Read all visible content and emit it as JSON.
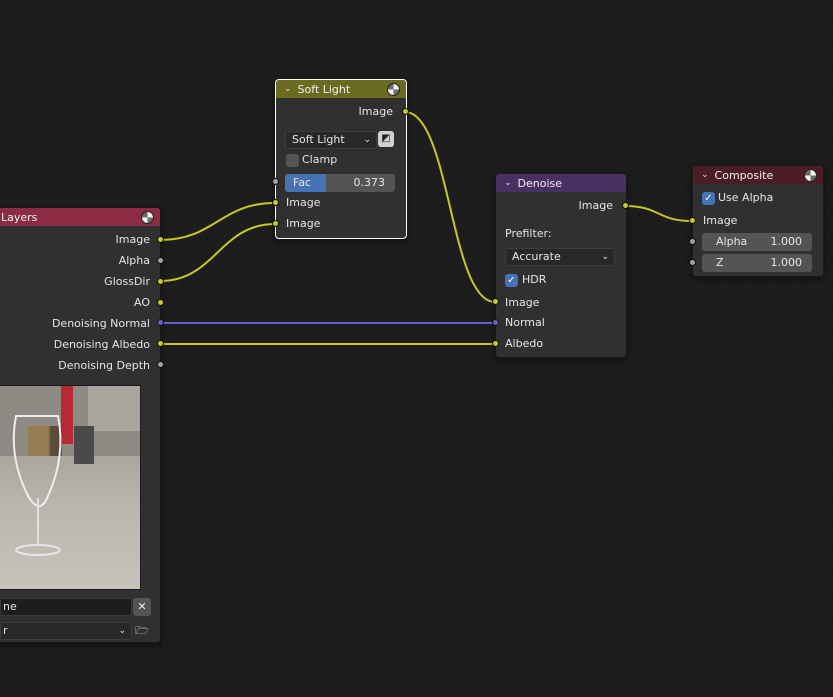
{
  "nodes": {
    "render_layers": {
      "title": "Layers",
      "outputs": [
        "Image",
        "Alpha",
        "GlossDir",
        "AO",
        "Denoising Normal",
        "Denoising Albedo",
        "Denoising Depth"
      ],
      "name_value": "ne",
      "select_value": "r",
      "colors": {
        "header": "#8b2b44"
      }
    },
    "soft_light": {
      "title": "Soft Light",
      "output_image": "Image",
      "blend_mode": "Soft Light",
      "clamp_label": "Clamp",
      "clamp_checked": false,
      "fac_label": "Fac",
      "fac_value": "0.373",
      "fac_fraction": 0.373,
      "input1": "Image",
      "input2": "Image",
      "colors": {
        "header": "#6b6b1f"
      }
    },
    "denoise": {
      "title": "Denoise",
      "output_image": "Image",
      "prefilter_label": "Prefilter:",
      "prefilter_value": "Accurate",
      "hdr_label": "HDR",
      "hdr_checked": true,
      "inputs": [
        "Image",
        "Normal",
        "Albedo"
      ],
      "colors": {
        "header": "#4a2f62"
      }
    },
    "composite": {
      "title": "Composite",
      "use_alpha_label": "Use Alpha",
      "use_alpha_checked": true,
      "input_image": "Image",
      "alpha_label": "Alpha",
      "alpha_value": "1.000",
      "z_label": "Z",
      "z_value": "1.000",
      "colors": {
        "header": "#4c1d26"
      }
    }
  },
  "icons": {
    "collapse": "chevron-down-icon",
    "node_preview": "sphere-icon",
    "clear": "close-icon",
    "browse": "folder-icon",
    "alpha_toggle": "image-alpha-icon"
  },
  "colors": {
    "link_color": "#c7c729",
    "vector_link": "#6363c7",
    "accent": "#4772b3"
  }
}
